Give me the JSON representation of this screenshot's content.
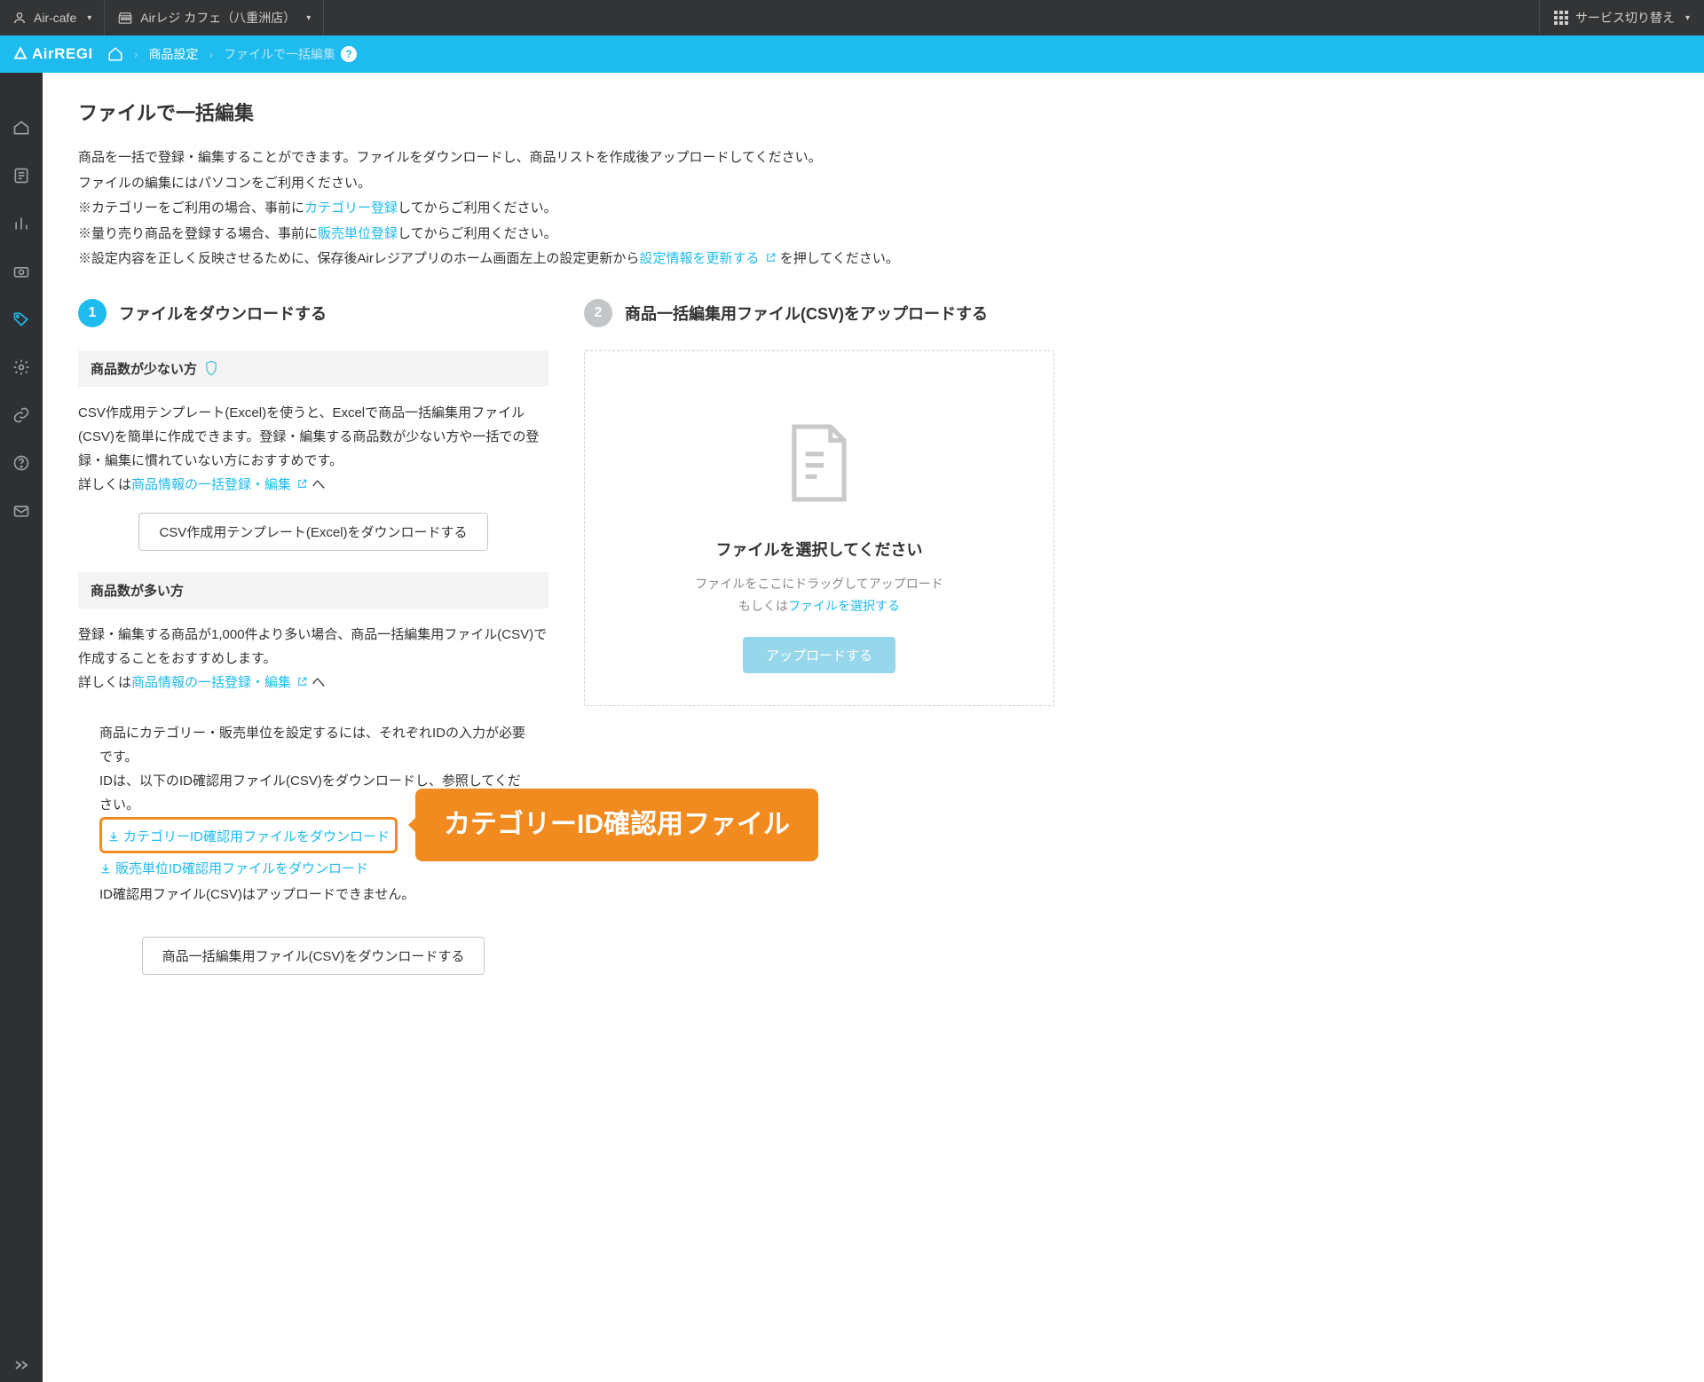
{
  "topbar": {
    "user": "Air-cafe",
    "store": "Airレジ カフェ（八重洲店）",
    "switch": "サービス切り替え"
  },
  "header": {
    "logo": "AirREGI",
    "crumbs": {
      "product": "商品設定",
      "current": "ファイルで一括編集"
    }
  },
  "page": {
    "title": "ファイルで一括編集",
    "intro": {
      "l1": "商品を一括で登録・編集することができます。ファイルをダウンロードし、商品リストを作成後アップロードしてください。",
      "l2": "ファイルの編集にはパソコンをご利用ください。",
      "l3a": "※カテゴリーをご利用の場合、事前に",
      "l3link": "カテゴリー登録",
      "l3b": "してからご利用ください。",
      "l4a": "※量り売り商品を登録する場合、事前に",
      "l4link": "販売単位登録",
      "l4b": "してからご利用ください。",
      "l5a": "※設定内容を正しく反映させるために、保存後Airレジアプリのホーム画面左上の設定更新から",
      "l5link": "設定情報を更新する",
      "l5b": "を押してください。"
    }
  },
  "step1": {
    "num": "1",
    "title": "ファイルをダウンロードする",
    "few": {
      "label": "商品数が少ない方",
      "body": "CSV作成用テンプレート(Excel)を使うと、Excelで商品一括編集用ファイル(CSV)を簡単に作成できます。登録・編集する商品数が少ない方や一括での登録・編集に慣れていない方におすすめです。",
      "detail_pre": "詳しくは",
      "detail_link": "商品情報の一括登録・編集",
      "detail_post": "へ",
      "button": "CSV作成用テンプレート(Excel)をダウンロードする"
    },
    "many": {
      "label": "商品数が多い方",
      "body": "登録・編集する商品が1,000件より多い場合、商品一括編集用ファイル(CSV)で作成することをおすすめします。",
      "detail_pre": "詳しくは",
      "detail_link": "商品情報の一括登録・編集",
      "detail_post": "へ",
      "note1": "商品にカテゴリー・販売単位を設定するには、それぞれIDの入力が必要です。",
      "note2": "IDは、以下のID確認用ファイル(CSV)をダウンロードし、参照してください。",
      "link_cat": "カテゴリーID確認用ファイルをダウンロード",
      "link_unit": "販売単位ID確認用ファイルをダウンロード",
      "note3": "ID確認用ファイル(CSV)はアップロードできません。",
      "button": "商品一括編集用ファイル(CSV)をダウンロードする"
    }
  },
  "step2": {
    "num": "2",
    "title": "商品一括編集用ファイル(CSV)をアップロードする",
    "dz_title": "ファイルを選択してください",
    "dz_sub1": "ファイルをここにドラッグしてアップロード",
    "dz_sub2a": "もしくは",
    "dz_sub2link": "ファイルを選択する",
    "upload": "アップロードする"
  },
  "callout": "カテゴリーID確認用ファイル"
}
